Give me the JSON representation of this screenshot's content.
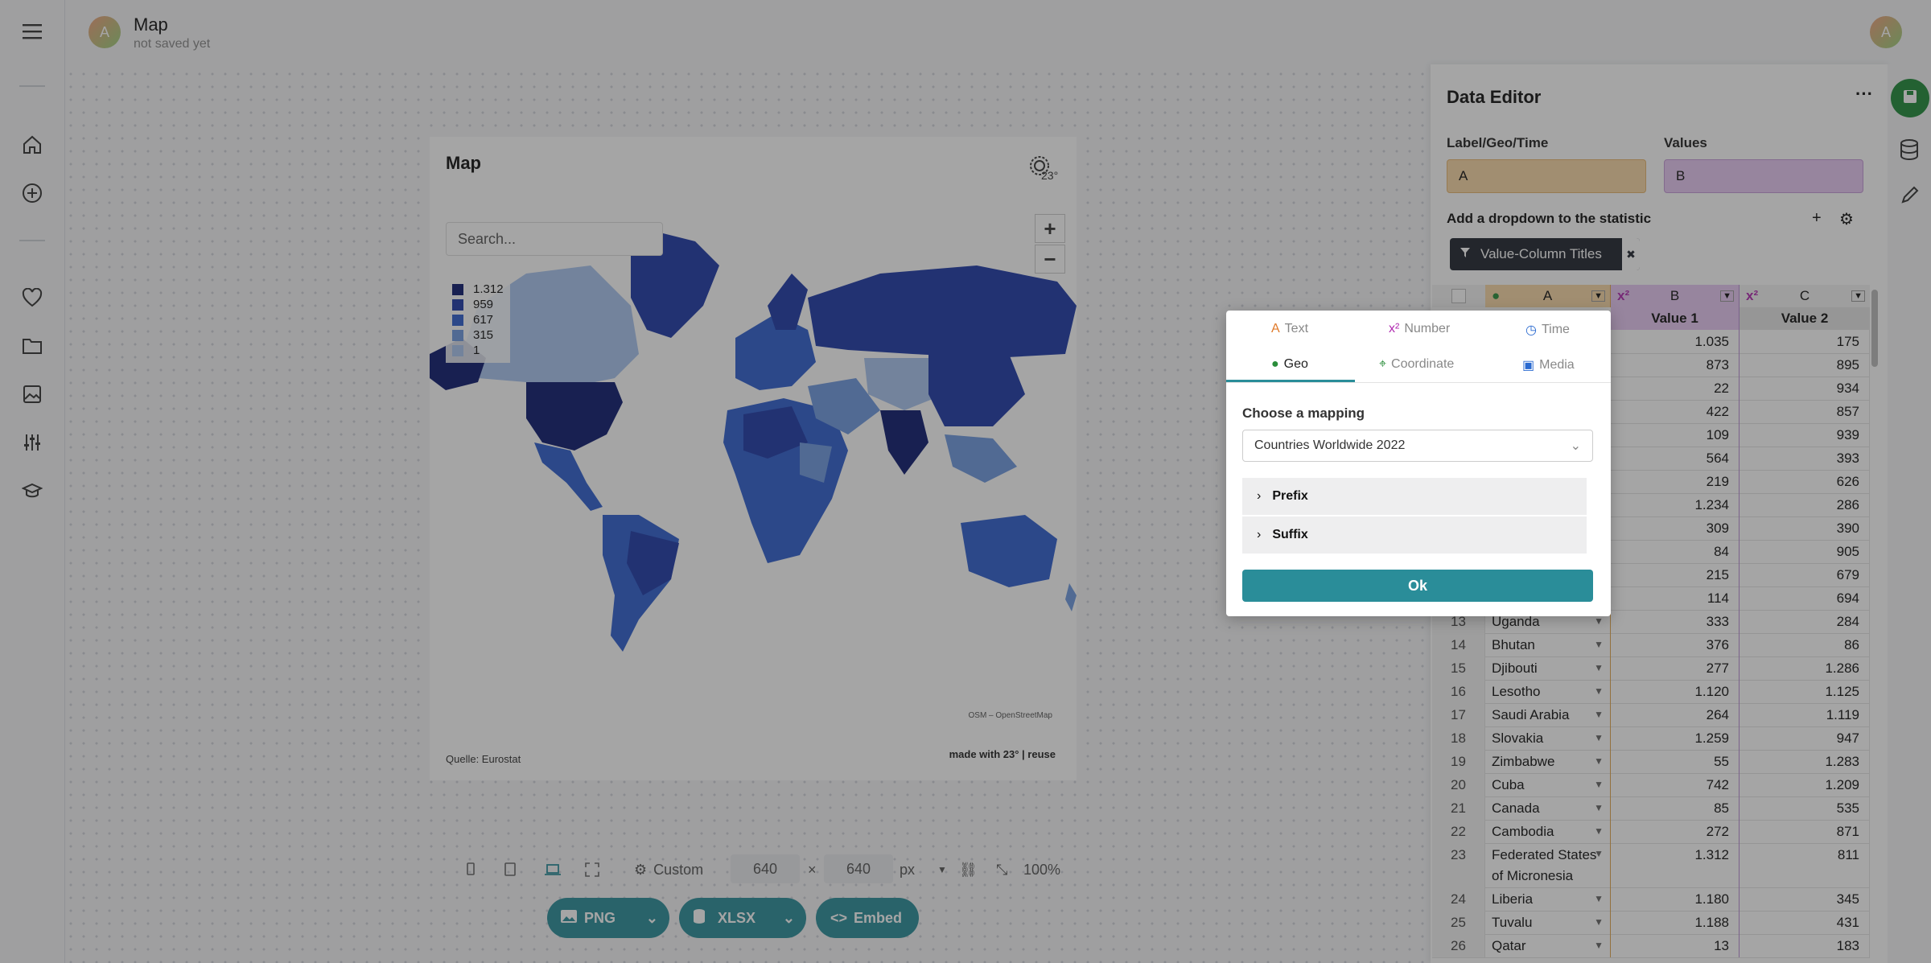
{
  "header": {
    "title": "Map",
    "subtitle": "not saved yet",
    "avatar_letter": "A",
    "user_avatar_letter": "A"
  },
  "rail": {
    "icons": [
      "menu-icon",
      "home-icon",
      "add-icon",
      "heart-icon",
      "folder-icon",
      "image-icon",
      "sliders-icon",
      "graduation-icon"
    ]
  },
  "map": {
    "title": "Map",
    "search_placeholder": "Search...",
    "zoom_in": "+",
    "zoom_out": "−",
    "legend": [
      {
        "label": "1.312",
        "color": "#0d1a6e"
      },
      {
        "label": "959",
        "color": "#1e3aa8"
      },
      {
        "label": "617",
        "color": "#2f5fcf"
      },
      {
        "label": "315",
        "color": "#6e99e0"
      },
      {
        "label": "1",
        "color": "#a9c4ef"
      }
    ],
    "attribution": "OSM – OpenStreetMap",
    "source": "Quelle: Eurostat",
    "made_with": "made with 23° | reuse",
    "logo": "23°"
  },
  "toolbar": {
    "preset": "Custom",
    "width": "640",
    "times": "×",
    "height": "640",
    "unit": "px",
    "zoom": "100%",
    "png": "PNG",
    "xlsx": "XLSX",
    "embed": "Embed"
  },
  "editor": {
    "title": "Data Editor",
    "more": "···",
    "label_geo_time": "Label/Geo/Time",
    "values": "Values",
    "label_col": "A",
    "value_col": "B",
    "dropdown_title": "Add a dropdown to the statistic",
    "add": "+",
    "chip": "Value-Column Titles",
    "chip_close": "✖",
    "columns": {
      "a": "A",
      "b": "B",
      "c": "C",
      "value1": "Value 1",
      "value2": "Value 2",
      "x2": "x²"
    },
    "rows_top": [
      {
        "b": "1.035",
        "c": "175"
      },
      {
        "b": "873",
        "c": "895"
      },
      {
        "b": "22",
        "c": "934"
      },
      {
        "b": "422",
        "c": "857"
      },
      {
        "b": "109",
        "c": "939"
      },
      {
        "b": "564",
        "c": "393"
      },
      {
        "b": "219",
        "c": "626"
      },
      {
        "b": "1.234",
        "c": "286"
      },
      {
        "b": "309",
        "c": "390"
      },
      {
        "b": "84",
        "c": "905"
      },
      {
        "b": "215",
        "c": "679"
      },
      {
        "b": "114",
        "c": "694"
      }
    ],
    "rows": [
      {
        "n": "13",
        "a": "Uganda",
        "b": "333",
        "c": "284"
      },
      {
        "n": "14",
        "a": "Bhutan",
        "b": "376",
        "c": "86"
      },
      {
        "n": "15",
        "a": "Djibouti",
        "b": "277",
        "c": "1.286"
      },
      {
        "n": "16",
        "a": "Lesotho",
        "b": "1.120",
        "c": "1.125"
      },
      {
        "n": "17",
        "a": "Saudi Arabia",
        "b": "264",
        "c": "1.119"
      },
      {
        "n": "18",
        "a": "Slovakia",
        "b": "1.259",
        "c": "947"
      },
      {
        "n": "19",
        "a": "Zimbabwe",
        "b": "55",
        "c": "1.283"
      },
      {
        "n": "20",
        "a": "Cuba",
        "b": "742",
        "c": "1.209"
      },
      {
        "n": "21",
        "a": "Canada",
        "b": "85",
        "c": "535"
      },
      {
        "n": "22",
        "a": "Cambodia",
        "b": "272",
        "c": "871"
      },
      {
        "n": "23",
        "a": "Federated States of Micronesia",
        "b": "1.312",
        "c": "811"
      },
      {
        "n": "24",
        "a": "Liberia",
        "b": "1.180",
        "c": "345"
      },
      {
        "n": "25",
        "a": "Tuvalu",
        "b": "1.188",
        "c": "431"
      },
      {
        "n": "26",
        "a": "Qatar",
        "b": "13",
        "c": "183"
      }
    ]
  },
  "popup": {
    "tabs": [
      {
        "label": "Text",
        "icon": "A"
      },
      {
        "label": "Number",
        "icon": "x²"
      },
      {
        "label": "Time",
        "icon": "◷"
      },
      {
        "label": "Geo",
        "icon": "●"
      },
      {
        "label": "Coordinate",
        "icon": "⌖"
      },
      {
        "label": "Media",
        "icon": "▣"
      }
    ],
    "choose_label": "Choose a mapping",
    "mapping": "Countries Worldwide 2022",
    "prefix": "Prefix",
    "suffix": "Suffix",
    "ok": "Ok"
  }
}
